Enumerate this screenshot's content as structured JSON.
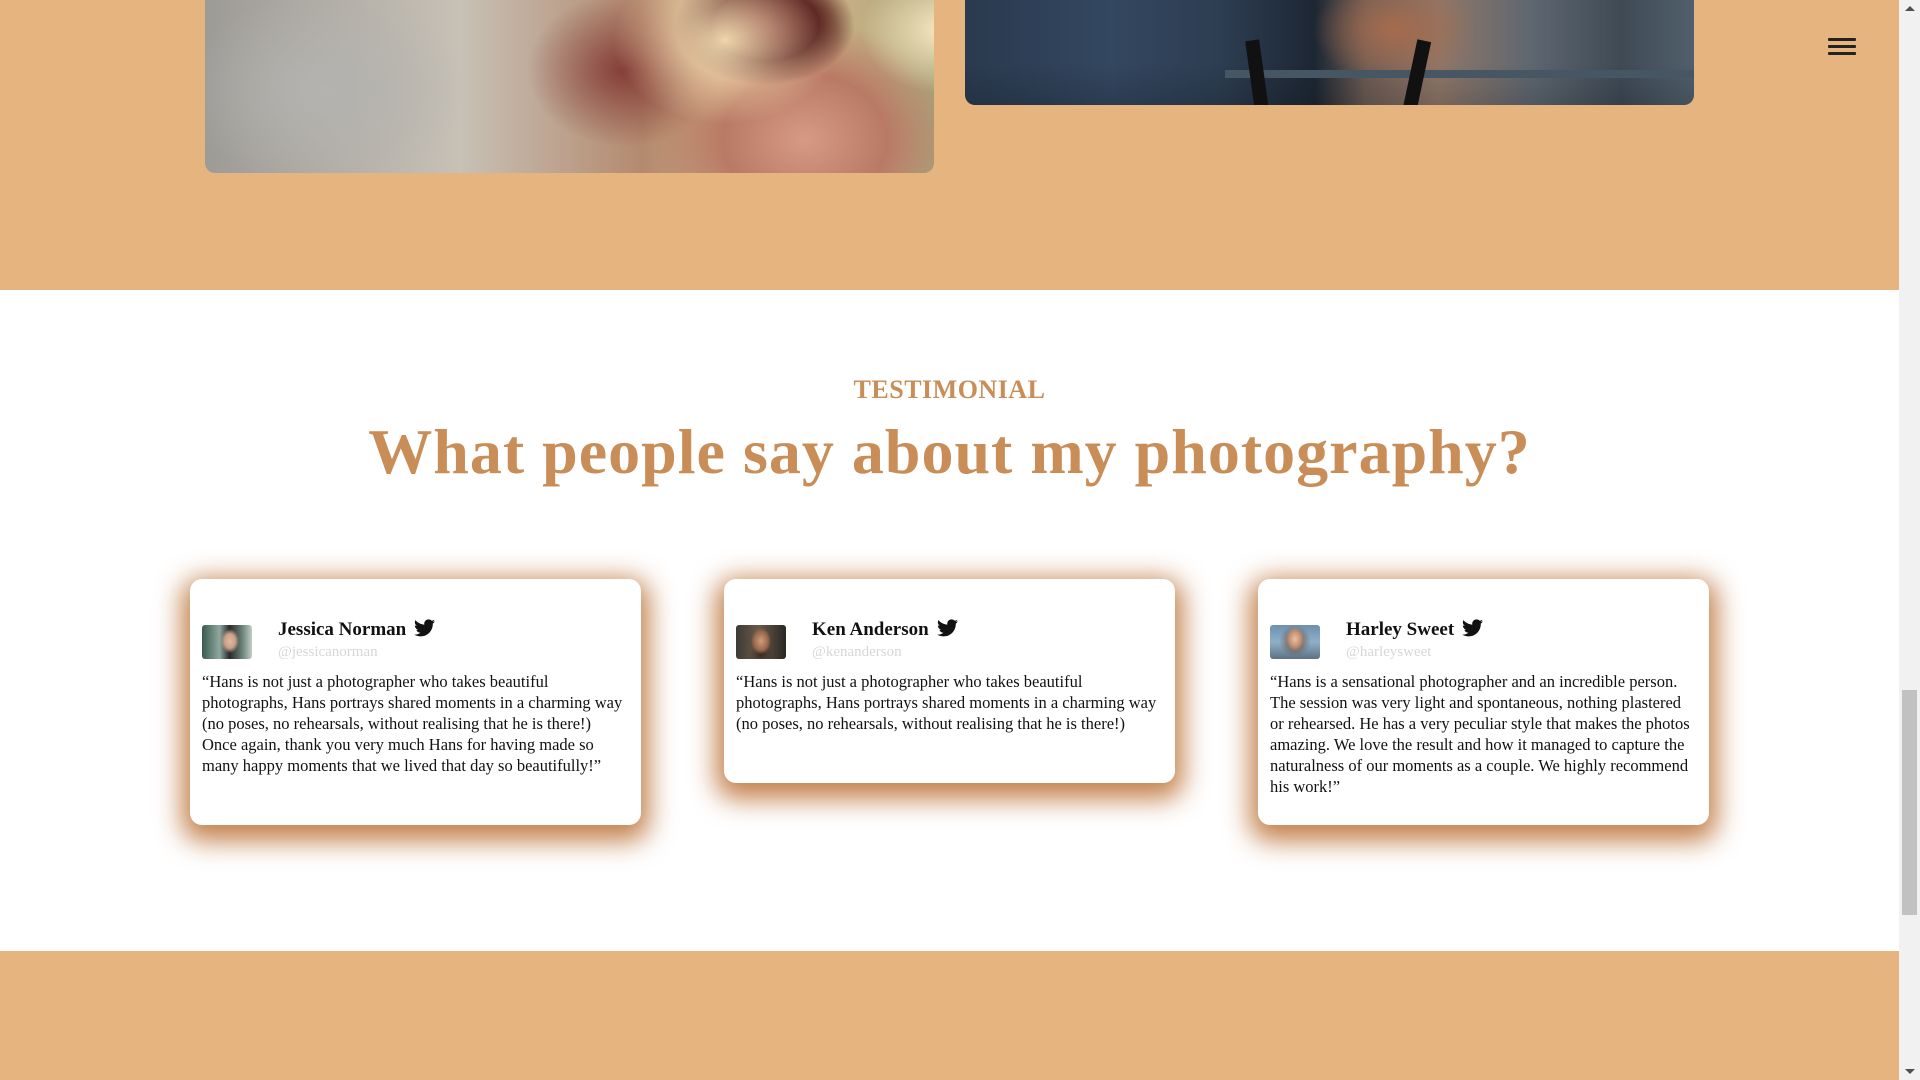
{
  "menu": {
    "icon": "hamburger-menu-icon"
  },
  "gallery": {
    "photos": [
      {
        "alt": ""
      },
      {
        "alt": ""
      }
    ]
  },
  "testimonial": {
    "eyebrow": "TESTIMONIAL",
    "headline": "What people say about my photography?",
    "cards": [
      {
        "name": "Jessica Norman",
        "handle": "@jessicanorman",
        "icon": "twitter-bird-icon",
        "quote": "“Hans is not just a photographer who takes beautiful photographs, Hans portrays shared moments in a charming way (no poses, no rehearsals, without realising that he is there!) Once again, thank you very much Hans for having made so many happy moments that we lived that day so beautifully!”"
      },
      {
        "name": "Ken Anderson",
        "handle": "@kenanderson",
        "icon": "twitter-bird-icon",
        "quote": "“Hans is not just a photographer who takes beautiful photographs, Hans portrays shared moments in a charming way (no poses, no rehearsals, without realising that he is there!)"
      },
      {
        "name": "Harley Sweet",
        "handle": "@harleysweet",
        "icon": "twitter-bird-icon",
        "quote": "“Hans is a sensational photographer and an incredible person. The session was very light and spontaneous, nothing plastered or rehearsed. He has a very peculiar style that makes the photos amazing. We love the result and how it managed to capture the naturalness of our moments as a couple. We highly recommend his work!”"
      }
    ]
  },
  "colors": {
    "accent": "#c98d58",
    "section_bg": "#e6b57f",
    "card_shadow": "#c07a42"
  }
}
